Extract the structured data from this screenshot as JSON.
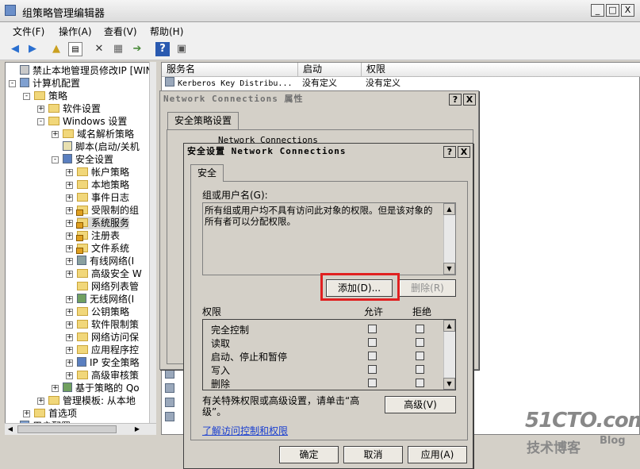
{
  "window": {
    "title": "组策略管理编辑器",
    "min": "_",
    "max": "□",
    "close": "X"
  },
  "menu": [
    "文件(F)",
    "操作(A)",
    "查看(V)",
    "帮助(H)"
  ],
  "toolbar": {
    "icons": [
      "back-icon",
      "forward-icon",
      "up-icon",
      "show-tree-icon",
      "delete-icon",
      "properties-icon",
      "export-icon",
      "help-icon",
      "view-icon"
    ]
  },
  "tree": {
    "items": [
      {
        "label": "禁止本地管理员修改IP [WIN-",
        "icon": "policy",
        "exp": "",
        "depth": 0
      },
      {
        "label": "计算机配置",
        "icon": "computer",
        "exp": "-",
        "depth": 0
      },
      {
        "label": "策略",
        "icon": "folder",
        "exp": "-",
        "depth": 1
      },
      {
        "label": "软件设置",
        "icon": "folder",
        "exp": "+",
        "depth": 2
      },
      {
        "label": "Windows 设置",
        "icon": "folder",
        "exp": "-",
        "depth": 2
      },
      {
        "label": "域名解析策略",
        "icon": "folder",
        "exp": "+",
        "depth": 3
      },
      {
        "label": "脚本(启动/关机",
        "icon": "script",
        "exp": "",
        "depth": 3
      },
      {
        "label": "安全设置",
        "icon": "shield",
        "exp": "-",
        "depth": 3
      },
      {
        "label": "帐户策略",
        "icon": "folder",
        "exp": "+",
        "depth": 4
      },
      {
        "label": "本地策略",
        "icon": "folder",
        "exp": "+",
        "depth": 4
      },
      {
        "label": "事件日志",
        "icon": "folder",
        "exp": "+",
        "depth": 4
      },
      {
        "label": "受限制的组",
        "icon": "lockfolder",
        "exp": "+",
        "depth": 4
      },
      {
        "label": "系统服务",
        "icon": "lockfolder",
        "exp": "+",
        "depth": 4
      },
      {
        "label": "注册表",
        "icon": "lockfolder",
        "exp": "+",
        "depth": 4
      },
      {
        "label": "文件系统",
        "icon": "lockfolder",
        "exp": "+",
        "depth": 4
      },
      {
        "label": "有线网络(I",
        "icon": "network",
        "exp": "+",
        "depth": 4
      },
      {
        "label": "高级安全 W",
        "icon": "folder",
        "exp": "+",
        "depth": 4
      },
      {
        "label": "网络列表管",
        "icon": "folder",
        "exp": "",
        "depth": 4
      },
      {
        "label": "无线网络(I",
        "icon": "chart",
        "exp": "+",
        "depth": 4
      },
      {
        "label": "公钥策略",
        "icon": "folder",
        "exp": "+",
        "depth": 4
      },
      {
        "label": "软件限制策",
        "icon": "folder",
        "exp": "+",
        "depth": 4
      },
      {
        "label": "网络访问保",
        "icon": "folder",
        "exp": "+",
        "depth": 4
      },
      {
        "label": "应用程序控",
        "icon": "folder",
        "exp": "+",
        "depth": 4
      },
      {
        "label": "IP 安全策略",
        "icon": "shield",
        "exp": "+",
        "depth": 4
      },
      {
        "label": "高级审核策",
        "icon": "folder",
        "exp": "+",
        "depth": 4
      },
      {
        "label": "基于策略的 Qo",
        "icon": "chart",
        "exp": "+",
        "depth": 3
      },
      {
        "label": "管理模板: 从本地",
        "icon": "folder",
        "exp": "+",
        "depth": 2
      },
      {
        "label": "首选项",
        "icon": "folder",
        "exp": "+",
        "depth": 1
      },
      {
        "label": "用户配置",
        "icon": "computer",
        "exp": "+",
        "depth": 0
      }
    ]
  },
  "list": {
    "headers": [
      "服务名",
      "启动",
      "权限"
    ],
    "rows": [
      {
        "name": "Kerberos Key Distribu...",
        "start": "没有定义",
        "perm": "没有定义"
      }
    ]
  },
  "props_dialog": {
    "title": "Network Connections 属性",
    "tab": "安全策略设置",
    "help": "?",
    "close": "X",
    "partial_text": "Network Connections"
  },
  "sec_dialog": {
    "title": "安全设置 Network Connections",
    "help": "?",
    "close": "X",
    "tab": "安全",
    "group_label": "组或用户名(G):",
    "info_text": "所有组或用户均不具有访问此对象的权限。但是该对象的所有者可以分配权限。",
    "add_button": "添加(D)...",
    "remove_button": "删除(R)",
    "perm_header": "权限",
    "allow_header": "允许",
    "deny_header": "拒绝",
    "permissions": [
      "完全控制",
      "读取",
      "启动、停止和暂停",
      "写入",
      "删除"
    ],
    "special_text": "有关特殊权限或高级设置，请单击“高级”。",
    "advanced_button": "高级(V)",
    "link": "了解访问控制和权限",
    "ok": "确定",
    "cancel": "取消",
    "apply": "应用(A)"
  },
  "watermark": {
    "brand": "51CTO.com",
    "sub": "技术博客",
    "blog": "Blog"
  }
}
